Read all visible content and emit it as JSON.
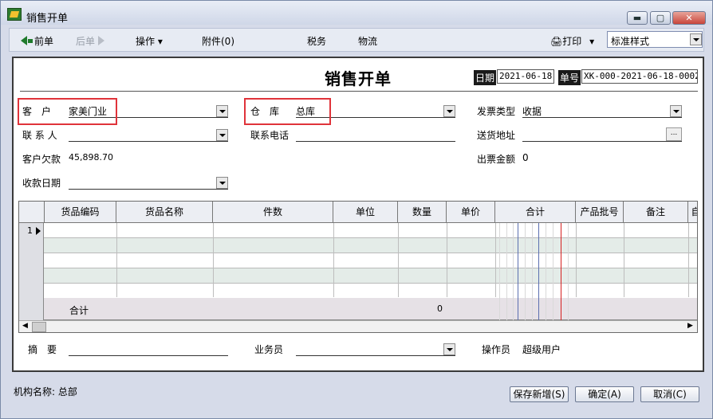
{
  "window": {
    "title": "销售开单"
  },
  "toolbar": {
    "prev_label": "前单",
    "next_label": "后单",
    "ops_label": "操作",
    "attach_label": "附件(0)",
    "tax_label": "税务",
    "logistics_label": "物流",
    "print_label": "打印",
    "style_value": "标准样式"
  },
  "form": {
    "title": "销售开单",
    "date_label": "日期",
    "date_value": "2021-06-18",
    "number_label": "单号",
    "number_value": "XK-000-2021-06-18-0002",
    "customer_label": "客　户",
    "customer_value": "家美门业",
    "warehouse_label": "仓　库",
    "warehouse_value": "总库",
    "invoice_type_label": "发票类型",
    "invoice_type_value": "收据",
    "contact_label": "联 系 人",
    "contact_value": "",
    "phone_label": "联系电话",
    "phone_value": "",
    "address_label": "送货地址",
    "address_value": "",
    "debt_label": "客户欠款",
    "debt_value": "45,898.70",
    "invoice_amount_label": "出票金额",
    "invoice_amount_value": "0",
    "collect_date_label": "收款日期",
    "collect_date_value": ""
  },
  "grid": {
    "columns": [
      "货品编码",
      "货品名称",
      "件数",
      "单位",
      "数量",
      "单价",
      "合计",
      "产品批号",
      "备注",
      "自"
    ],
    "rows": [
      {
        "row_no": "1"
      },
      {
        "row_no": ""
      },
      {
        "row_no": ""
      },
      {
        "row_no": ""
      },
      {
        "row_no": ""
      }
    ],
    "sum_label": "合计",
    "sum_quantity": "0"
  },
  "footer": {
    "summary_label": "摘　要",
    "summary_value": "",
    "salesperson_label": "业务员",
    "salesperson_value": "",
    "operator_label": "操作员",
    "operator_value": "超级用户"
  },
  "status": {
    "org_label": "机构名称: 总部",
    "save_new_label": "保存新增(S)",
    "confirm_label": "确定(A)",
    "cancel_label": "取消(C)"
  },
  "colors": {
    "highlight": "#e0333a",
    "grid_alt": "#e4ece8",
    "sum_row": "#e6e1e6"
  }
}
